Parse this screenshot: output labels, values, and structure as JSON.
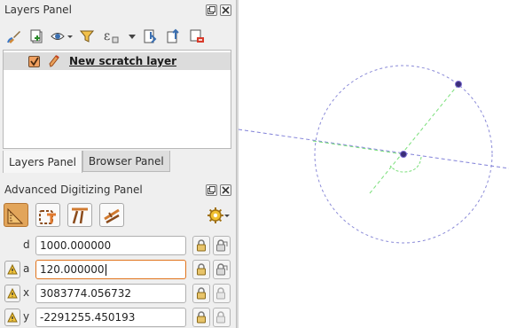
{
  "layers_panel": {
    "title": "Layers Panel",
    "toolbar_icons": [
      "paint-brush-icon",
      "add-group-icon",
      "eye-visibility-icon",
      "filter-icon",
      "expression-filter-icon",
      "dropdown-icon",
      "expand-all-icon",
      "collapse-all-icon",
      "remove-layer-icon"
    ],
    "layers": [
      {
        "name": "New scratch layer",
        "checked": true,
        "icon": "pencil-edit-icon"
      }
    ]
  },
  "tabs": [
    {
      "label": "Layers Panel",
      "active": true
    },
    {
      "label": "Browser Panel",
      "active": false
    }
  ],
  "digitizing_panel": {
    "title": "Advanced Digitizing Panel",
    "tool_icons": [
      "enable-advanced-digitizing-icon",
      "construction-mode-icon",
      "parallel-icon",
      "perpendicular-icon"
    ],
    "settings_icon": "gear-icon",
    "fields": [
      {
        "label": "d",
        "value": "1000.000000",
        "has_warning": false,
        "focused": false
      },
      {
        "label": "a",
        "value": "120.000000",
        "has_warning": true,
        "focused": true
      },
      {
        "label": "x",
        "value": "3083774.056732",
        "has_warning": true,
        "focused": false
      },
      {
        "label": "y",
        "value": "-2291255.450193",
        "has_warning": true,
        "focused": false
      }
    ]
  },
  "canvas": {
    "colors": {
      "circle": "#8b8bd8",
      "line_axis": "#8080d8",
      "angle_line": "#7adf7a",
      "vertex": "#3a2e78"
    }
  }
}
